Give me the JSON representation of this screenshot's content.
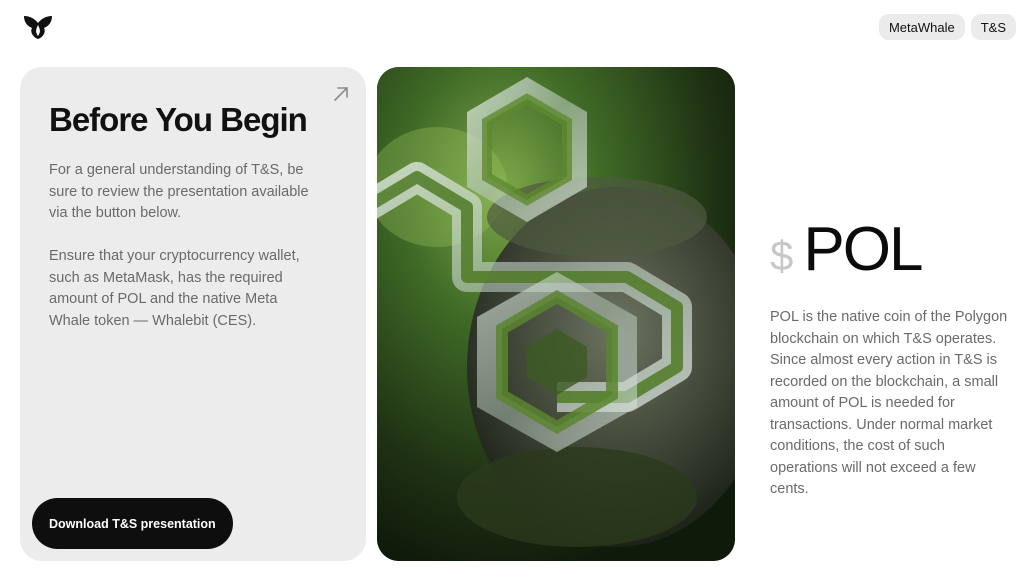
{
  "header": {
    "logo_icon": "whale-tail-logo-icon",
    "nav": [
      {
        "label": "MetaWhale"
      },
      {
        "label": "T&S"
      }
    ]
  },
  "intro_card": {
    "title": "Before You Begin",
    "paragraph1": "For a general understanding of T&S, be sure to review the presentation available via the button below.",
    "paragraph2": "Ensure that your cryptocurrency wallet, such as MetaMask, has the required amount of POL and the native Meta Whale token — Whalebit (CES).",
    "download_button": "Download T&S presentation",
    "arrow_icon": "arrow-up-right-icon"
  },
  "hero_image": {
    "icon": "polygon-logo-moss-sculpture"
  },
  "pol_section": {
    "currency_symbol": "$",
    "title": "POL",
    "description": "POL is the native coin of the Polygon blockchain on which T&S operates. Since almost every action in T&S is recorded on the blockchain, a small amount of POL is needed for transactions. Under normal market conditions, the cost of such operations will not exceed a few cents."
  },
  "colors": {
    "card_bg": "#ececec",
    "button_bg": "#0e0e0e",
    "pill_bg": "#ebebeb",
    "muted_text": "#6a6a6a"
  }
}
